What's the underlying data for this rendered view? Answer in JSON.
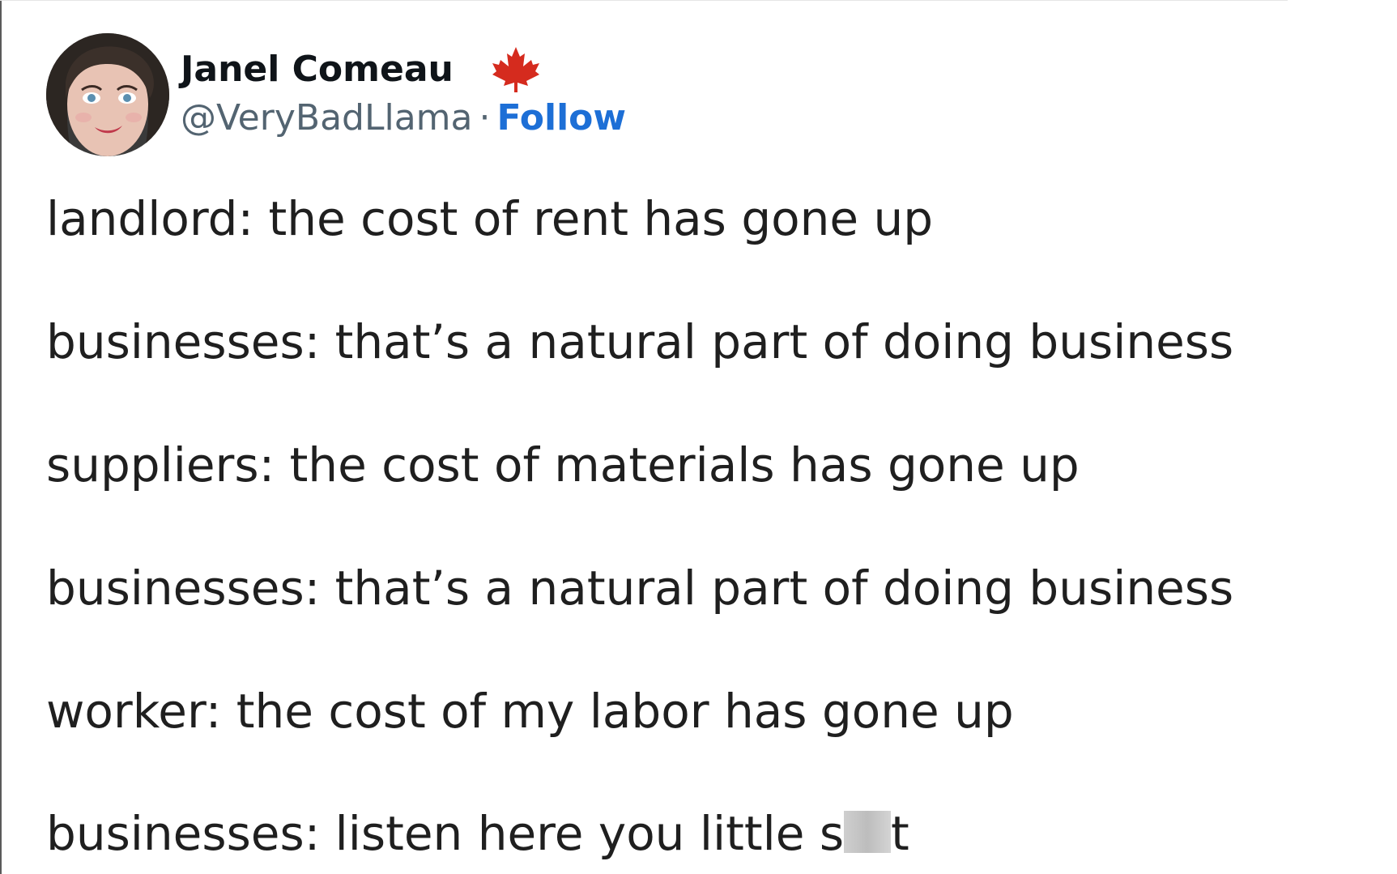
{
  "author": {
    "display_name": "Janel Comeau",
    "handle": "@VeryBadLlama",
    "separator": "·",
    "follow_label": "Follow",
    "flag_icon": "canada-maple-leaf-icon"
  },
  "tweet": {
    "lines": [
      "landlord: the cost of rent has gone up",
      "businesses: that’s a natural part of doing business",
      "suppliers: the cost of materials has gone up",
      "businesses: that’s a natural part of doing business",
      "worker: the cost of my labor has gone up"
    ],
    "last_line_prefix": "businesses: listen here you little s",
    "last_line_suffix": "t"
  },
  "colors": {
    "follow": "#1d6fd6",
    "handle": "#536471",
    "flag": "#d52b1e"
  }
}
